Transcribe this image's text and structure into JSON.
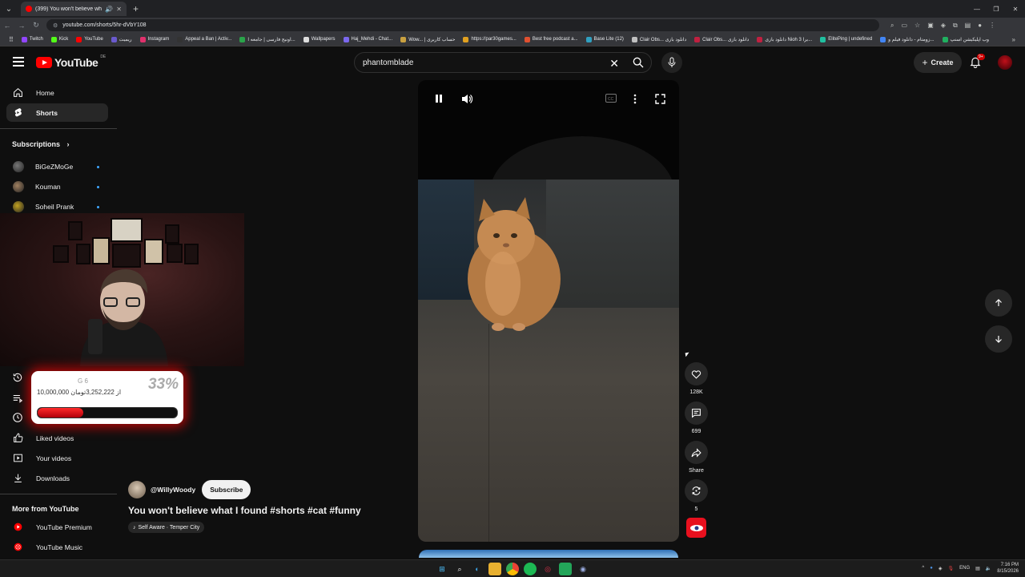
{
  "browser": {
    "tab_title": "(399) You won't believe wh...",
    "url": "youtube.com/shorts/5hr-dVbY108",
    "bookmarks": [
      {
        "label": "Twitch",
        "color": "#9146ff"
      },
      {
        "label": "Kick",
        "color": "#53fc18"
      },
      {
        "label": "YouTube",
        "color": "#ff0000"
      },
      {
        "label": "ریمیت",
        "color": "#6a5acd"
      },
      {
        "label": "Instagram",
        "color": "#e1306c"
      },
      {
        "label": "Appeal a Ban | Activ...",
        "color": "#333333"
      },
      {
        "label": "اونیج فارسی | جامعه ا...",
        "color": "#2aa34a"
      },
      {
        "label": "Wallpapers",
        "color": "#dddddd"
      },
      {
        "label": "Haj_Mehdi - Chat...",
        "color": "#7b68ee"
      },
      {
        "label": "Wow... | حساب کاربری",
        "color": "#c8a040"
      },
      {
        "label": "https://par30games...",
        "color": "#e0a020"
      },
      {
        "label": "Best free podcast a...",
        "color": "#e05030"
      },
      {
        "label": "Base Lite (12)",
        "color": "#30a0c0"
      },
      {
        "label": "Clair Obs... دانلود بازی",
        "color": "#c0c0c0"
      },
      {
        "label": "Clair Obs... دانلود بازی",
        "color": "#c02040"
      },
      {
        "label": "دانلود بازی Nioh 3 برا...",
        "color": "#c02040"
      },
      {
        "label": "ElitePing | undefined",
        "color": "#20c0a0"
      },
      {
        "label": "زومتام - دانلود فیلم و...",
        "color": "#4285f4"
      },
      {
        "label": "وب اپلیکیشن اسنپ",
        "color": "#20b060"
      }
    ]
  },
  "header": {
    "logo_text": "YouTube",
    "logo_country": "DE",
    "search_value": "phantomblade",
    "create_label": "Create",
    "notif_badge": "9+"
  },
  "sidebar": {
    "home": "Home",
    "shorts": "Shorts",
    "subscriptions_header": "Subscriptions",
    "subscriptions": [
      {
        "name": "BiGeZMoGe",
        "color": "#777777"
      },
      {
        "name": "Kouman",
        "color": "#a08060"
      },
      {
        "name": "Soheil Prank",
        "color": "#c0a020"
      }
    ],
    "liked": "Liked videos",
    "your_videos": "Your videos",
    "downloads": "Downloads",
    "more_header": "More from YouTube",
    "premium": "YouTube Premium",
    "music": "YouTube Music"
  },
  "donation": {
    "goal": "G 6",
    "amount_text": "10,000,000 از 3,252,222تومان",
    "percent_text": "33%",
    "progress": 0.33
  },
  "video": {
    "channel": "@WillyWoody",
    "subscribe_label": "Subscribe",
    "title": "You won't believe what I found #shorts #cat #funny",
    "sound": "Self Aware · Temper City"
  },
  "actions": {
    "likes": "128K",
    "comments": "699",
    "share": "Share",
    "remix": "5"
  },
  "taskbar": {
    "lang": "ENG",
    "time": "7:16 PM",
    "date": "8/15/2026"
  }
}
